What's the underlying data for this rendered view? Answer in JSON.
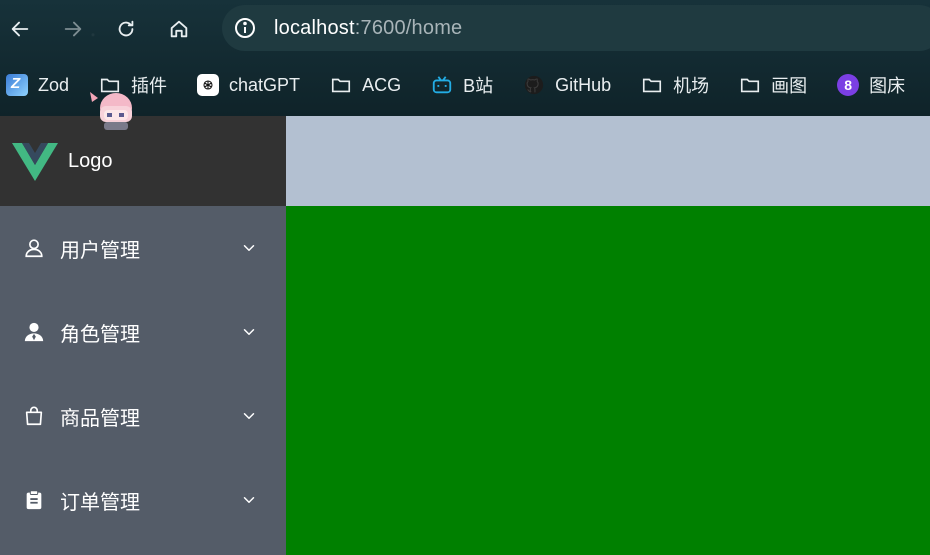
{
  "browser": {
    "url_host": "localhost",
    "url_rest": ":7600/home",
    "bookmarks": [
      {
        "label": "Zod",
        "icon": "zod-icon"
      },
      {
        "label": "插件",
        "icon": "folder-icon"
      },
      {
        "label": "chatGPT",
        "icon": "chatgpt-icon"
      },
      {
        "label": "ACG",
        "icon": "folder-icon"
      },
      {
        "label": "B站",
        "icon": "bilibili-icon"
      },
      {
        "label": "GitHub",
        "icon": "github-icon"
      },
      {
        "label": "机场",
        "icon": "folder-icon"
      },
      {
        "label": "画图",
        "icon": "folder-icon"
      },
      {
        "label": "图床",
        "icon": "circle-8-icon"
      }
    ]
  },
  "sidebar": {
    "logo_text": "Logo",
    "items": [
      {
        "label": "用户管理",
        "icon": "user-outline-icon"
      },
      {
        "label": "角色管理",
        "icon": "user-filled-icon"
      },
      {
        "label": "商品管理",
        "icon": "shopping-bag-icon"
      },
      {
        "label": "订单管理",
        "icon": "clipboard-icon"
      }
    ]
  },
  "colors": {
    "sidebar_bg": "#545c68",
    "logo_bg": "#323232",
    "header_bg": "#b3c0d1",
    "main_bg": "#008000",
    "vue_green": "#42b883",
    "vue_dark": "#35495e"
  }
}
